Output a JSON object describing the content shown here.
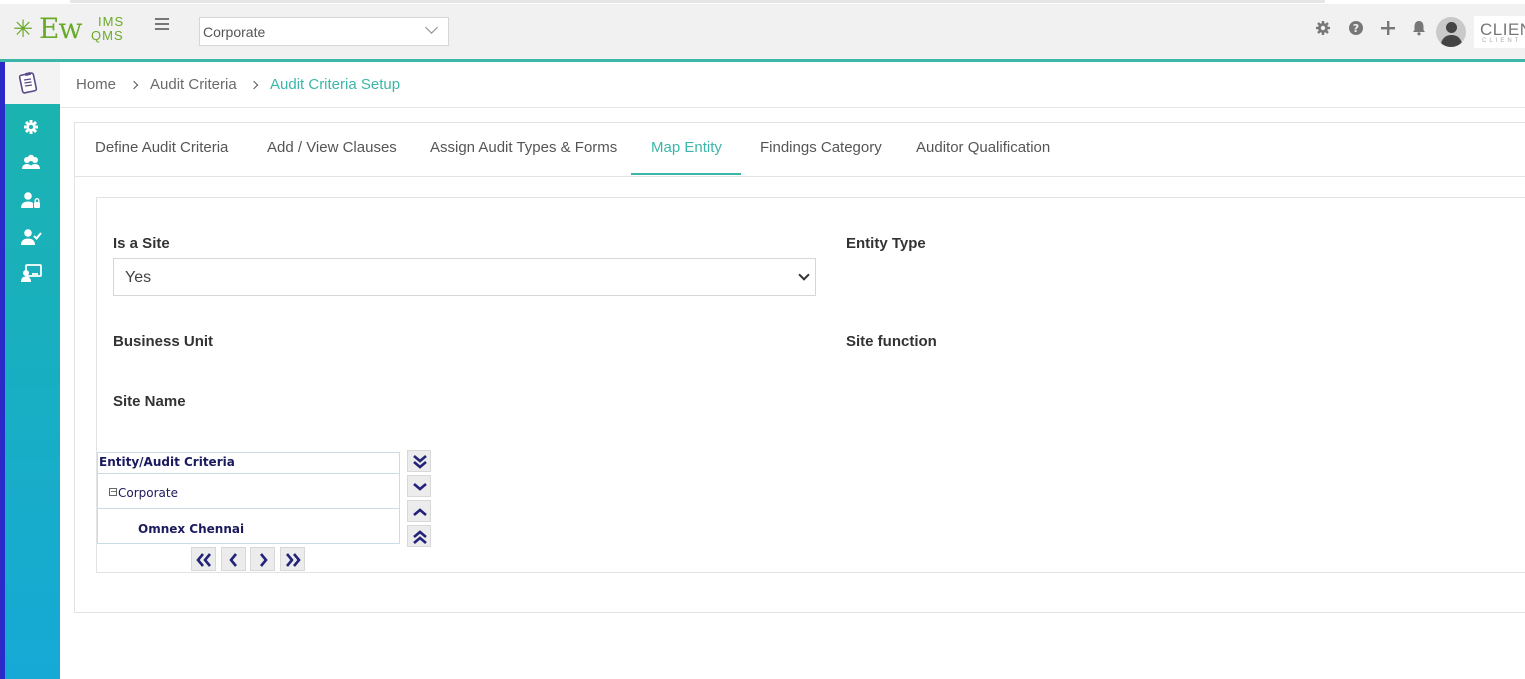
{
  "header": {
    "logo_main": "Ew",
    "logo_ims": "IMS",
    "logo_qms": "QMS",
    "org_select_value": "Corporate",
    "icons": [
      "gear-icon",
      "help-icon",
      "plus-icon",
      "bell-icon",
      "avatar"
    ],
    "client_logo_text": "CLIENT",
    "client_logo_sub": "CLIENT"
  },
  "sidebar": {
    "items": [
      "clipboard-icon",
      "settings-icon",
      "users-group-icon",
      "user-lock-icon",
      "user-check-icon",
      "presentation-icon"
    ]
  },
  "breadcrumb": {
    "home": "Home",
    "level1": "Audit Criteria",
    "current": "Audit Criteria Setup"
  },
  "tabs": [
    {
      "label": "Define Audit Criteria"
    },
    {
      "label": "Add / View Clauses"
    },
    {
      "label": "Assign Audit Types & Forms"
    },
    {
      "label": "Map Entity"
    },
    {
      "label": "Findings Category"
    },
    {
      "label": "Auditor Qualification"
    }
  ],
  "active_tab": "Map Entity",
  "form": {
    "is_a_site_label": "Is a Site",
    "is_a_site_value": "Yes",
    "entity_type_label": "Entity Type",
    "business_unit_label": "Business Unit",
    "site_function_label": "Site function",
    "site_name_label": "Site Name"
  },
  "tree": {
    "header": "Entity/Audit Criteria",
    "expand_symbol": "−",
    "rows": [
      {
        "label": "Corporate",
        "expanded": true
      },
      {
        "label": "Omnex Chennai"
      }
    ]
  },
  "colors": {
    "accent": "#3cb6a8",
    "sidebar_top": "#1bb4ad",
    "sidebar_bottom": "#16a9d6",
    "logo_green": "#6aaa2a",
    "tree_text": "#1a1a5e"
  }
}
